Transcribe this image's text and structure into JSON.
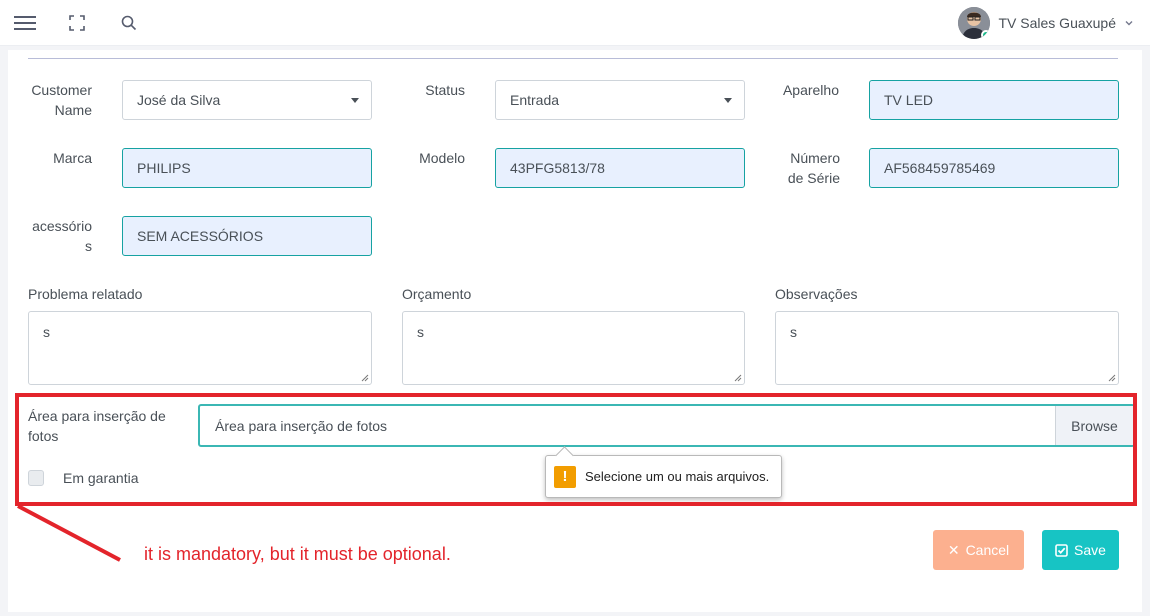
{
  "header": {
    "user_name": "TV Sales Guaxupé"
  },
  "icons": {
    "menu": "hamburger-menu-icon",
    "fullscreen": "fullscreen-icon",
    "search": "search-icon",
    "dropdown": "chevron-down-icon"
  },
  "form": {
    "customer_name_label": "Customer Name",
    "customer_name_value": "José da Silva",
    "status_label": "Status",
    "status_value": "Entrada",
    "aparelho_label": "Aparelho",
    "aparelho_value": "TV LED",
    "marca_label": "Marca",
    "marca_value": "PHILIPS",
    "modelo_label": "Modelo",
    "modelo_value": "43PFG5813/78",
    "serie_label": "Número de Série",
    "serie_value": "AF568459785469",
    "acessorios_label": "acessórios",
    "acessorios_value": "SEM ACESSÓRIOS",
    "problema_label": "Problema relatado",
    "problema_value": "s",
    "orcamento_label": "Orçamento",
    "orcamento_value": "s",
    "observacoes_label": "Observações",
    "observacoes_value": "s",
    "fotos_label": "Área para inserção de fotos",
    "fotos_placeholder": "Área para inserção de fotos",
    "browse_label": "Browse",
    "validation_message": "Selecione um ou mais arquivos.",
    "garantia_label": "Em garantia",
    "cancel_label": "Cancel",
    "save_label": "Save"
  },
  "annotation": {
    "text": "it is mandatory, but it must be optional."
  },
  "colors": {
    "accent": "#17c4c4",
    "cancel": "#fcb08f",
    "annotation": "#e3242b",
    "warning": "#f29d00",
    "filled_field": "#e8f0fe"
  }
}
